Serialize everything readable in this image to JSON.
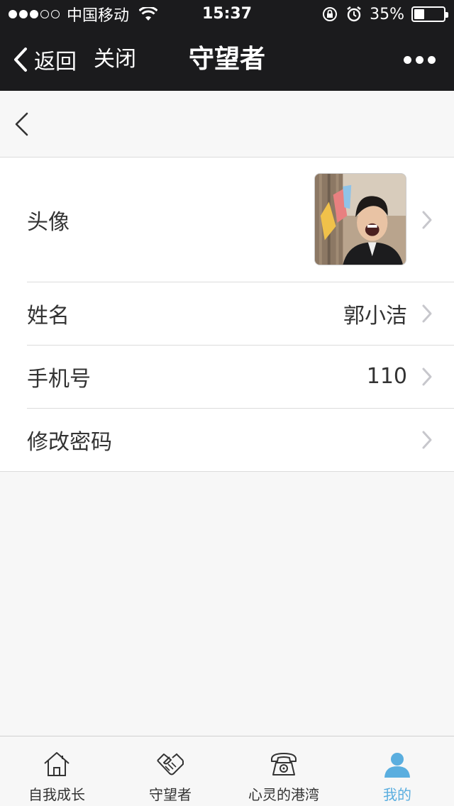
{
  "status_bar": {
    "carrier": "中国移动",
    "time": "15:37",
    "battery": "35%",
    "battery_level": 0.35
  },
  "navbar": {
    "back_label": "返回",
    "close_label": "关闭",
    "title": "守望者"
  },
  "profile": {
    "avatar_label": "头像",
    "name_label": "姓名",
    "name_value": "郭小洁",
    "phone_label": "手机号",
    "phone_value": "110",
    "password_label": "修改密码"
  },
  "tabs": [
    {
      "label": "自我成长",
      "icon": "home-icon"
    },
    {
      "label": "守望者",
      "icon": "handshake-icon"
    },
    {
      "label": "心灵的港湾",
      "icon": "telephone-icon"
    },
    {
      "label": "我的",
      "icon": "person-icon",
      "active": true
    }
  ],
  "colors": {
    "bar_background": "#1b1b1d",
    "active_tab": "#5aaedf"
  }
}
